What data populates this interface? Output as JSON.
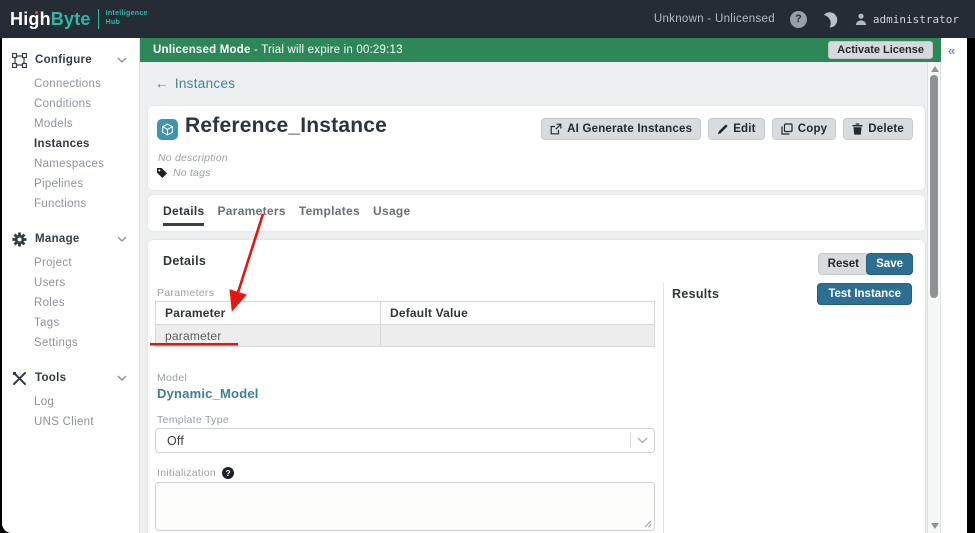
{
  "header": {
    "logo": {
      "high": "High",
      "byte": "Byte",
      "tagline_line1": "Intelligence",
      "tagline_line2": "Hub"
    },
    "license_status": "Unknown - Unlicensed",
    "help_glyph": "?",
    "username": "administrator"
  },
  "banner": {
    "bold_text": "Unlicensed Mode",
    "rest_text": " - Trial will expire in 00:29:13",
    "activate_button": "Activate License"
  },
  "right_rail": {
    "collapse_icon": "«"
  },
  "sidebar": {
    "sections": [
      {
        "label": "Configure",
        "items": [
          "Connections",
          "Conditions",
          "Models",
          "Instances",
          "Namespaces",
          "Pipelines",
          "Functions"
        ]
      },
      {
        "label": "Manage",
        "items": [
          "Project",
          "Users",
          "Roles",
          "Tags",
          "Settings"
        ]
      },
      {
        "label": "Tools",
        "items": [
          "Log",
          "UNS Client"
        ]
      }
    ],
    "active_item": "Instances"
  },
  "main": {
    "back_arrow": "←",
    "back_link": "Instances",
    "title": "Reference_Instance",
    "description": "No description",
    "tags": "No tags",
    "actions": {
      "ai_generate": "AI Generate Instances",
      "edit": "Edit",
      "copy": "Copy",
      "delete": "Delete"
    },
    "tabs": [
      "Details",
      "Parameters",
      "Templates",
      "Usage"
    ],
    "active_tab": "Details",
    "details": {
      "heading": "Details",
      "reset_button": "Reset",
      "save_button": "Save",
      "parameters_label": "Parameters",
      "table": {
        "headers": [
          "Parameter",
          "Default Value"
        ],
        "rows": [
          [
            "parameter",
            ""
          ]
        ]
      },
      "model_label": "Model",
      "model_value": "Dynamic_Model",
      "template_type_label": "Template Type",
      "template_type_value": "Off",
      "initialization_label": "Initialization",
      "help_glyph": "?"
    },
    "results": {
      "heading": "Results",
      "test_button": "Test Instance"
    }
  },
  "colors": {
    "header_dark": "#262c35",
    "logo_teal": "#2cb7a6",
    "banner_green": "#2e8757",
    "primary_blue": "#2c6f92",
    "instance_icon_blue": "#3f93b5",
    "annotation_red": "#e3170d"
  }
}
